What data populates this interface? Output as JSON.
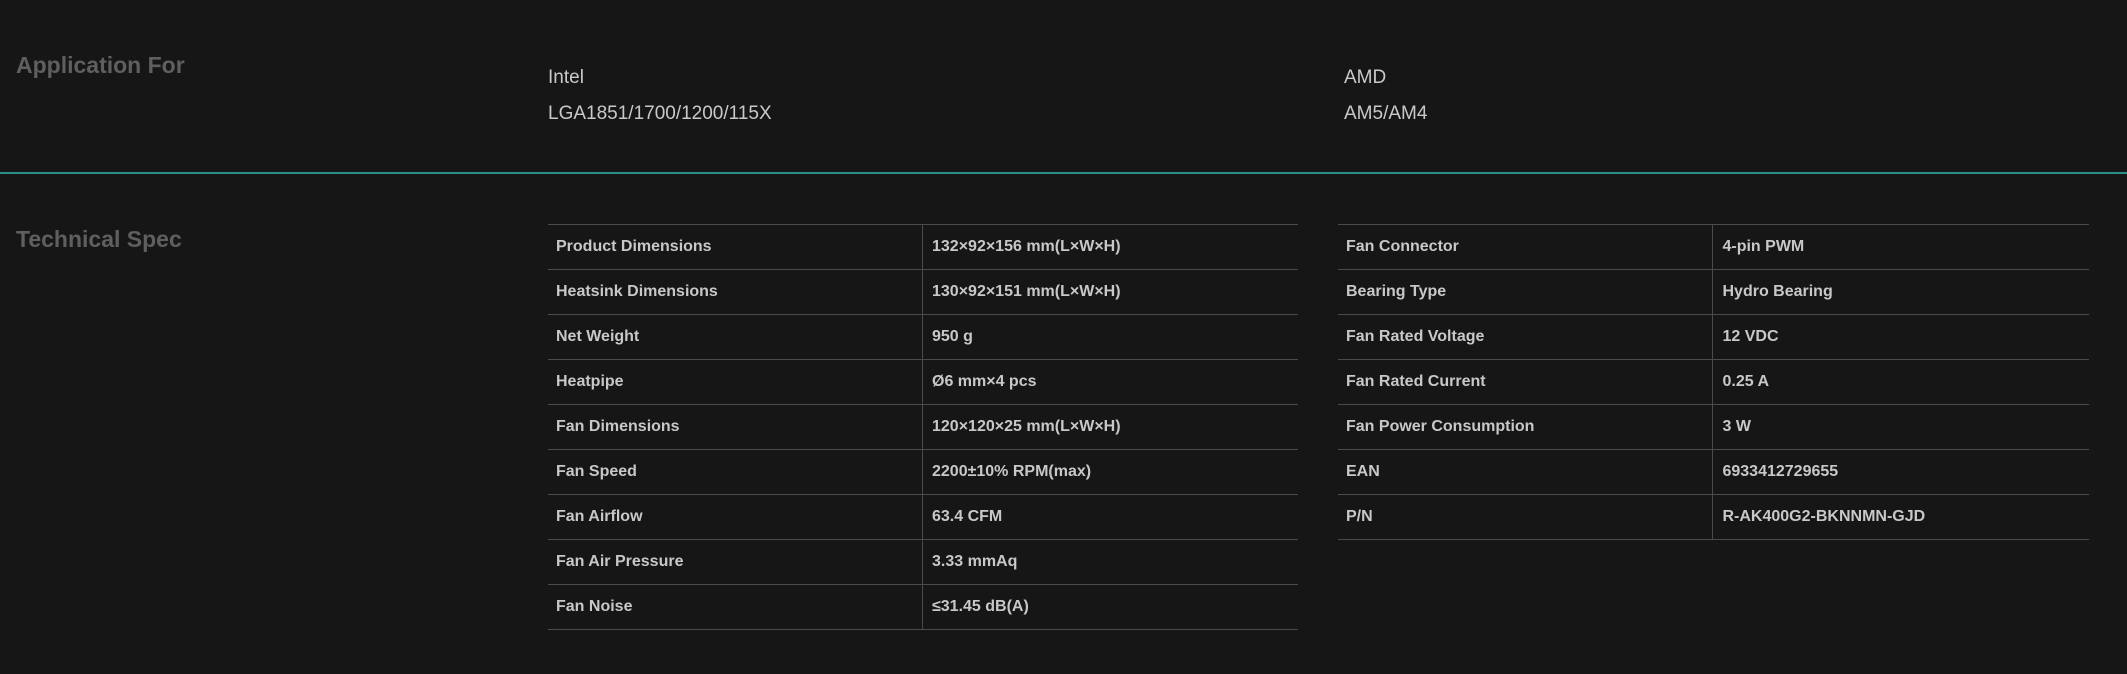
{
  "application": {
    "heading": "Application For",
    "intel": {
      "name": "Intel",
      "sockets": "LGA1851/1700/1200/115X"
    },
    "amd": {
      "name": "AMD",
      "sockets": "AM5/AM4"
    }
  },
  "technical_spec": {
    "heading": "Technical Spec",
    "left": [
      {
        "label": "Product Dimensions",
        "value": "132×92×156 mm(L×W×H)"
      },
      {
        "label": "Heatsink Dimensions",
        "value": "130×92×151 mm(L×W×H)"
      },
      {
        "label": "Net Weight",
        "value": "950 g"
      },
      {
        "label": "Heatpipe",
        "value": "Ø6 mm×4 pcs"
      },
      {
        "label": "Fan Dimensions",
        "value": "120×120×25 mm(L×W×H)"
      },
      {
        "label": "Fan Speed",
        "value": "2200±10% RPM(max)"
      },
      {
        "label": "Fan Airflow",
        "value": "63.4 CFM"
      },
      {
        "label": "Fan Air Pressure",
        "value": "3.33 mmAq"
      },
      {
        "label": "Fan Noise",
        "value": "≤31.45 dB(A)"
      }
    ],
    "right": [
      {
        "label": "Fan Connector",
        "value": "4-pin PWM"
      },
      {
        "label": "Bearing Type",
        "value": "Hydro Bearing"
      },
      {
        "label": "Fan Rated Voltage",
        "value": "12 VDC"
      },
      {
        "label": "Fan Rated Current",
        "value": "0.25 A"
      },
      {
        "label": "Fan Power Consumption",
        "value": "3 W"
      },
      {
        "label": "EAN",
        "value": "6933412729655"
      },
      {
        "label": "P/N",
        "value": "R-AK400G2-BKNNMN-GJD"
      }
    ]
  },
  "colors": {
    "background": "#161617",
    "divider": "#2a8f86",
    "heading": "#5f5f60",
    "text": "#c8c8c8"
  }
}
